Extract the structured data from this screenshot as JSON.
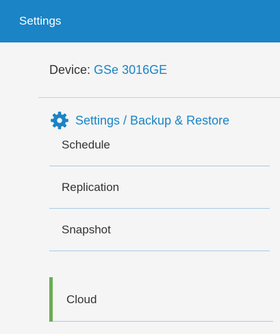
{
  "header": {
    "title": "Settings",
    "background_color": "#1a84c6"
  },
  "device": {
    "prefix": "Device:",
    "name": "GSe 3016GE"
  },
  "section": {
    "icon": "gear-icon",
    "title": "Settings / Backup & Restore"
  },
  "menu": {
    "items": [
      {
        "label": "Schedule"
      },
      {
        "label": "Replication"
      },
      {
        "label": "Snapshot"
      },
      {
        "label": "Cloud",
        "active": true
      }
    ],
    "active_indicator_color": "#6aad53",
    "separator_color": "#a8c9e8"
  }
}
